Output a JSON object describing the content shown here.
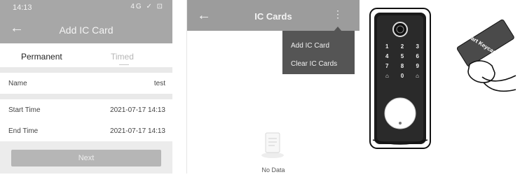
{
  "screen_add_ic_card": {
    "status_time": "14:13",
    "status_icons": "4G ✓ ⊡",
    "title": "Add IC Card",
    "tabs": [
      "Permanent",
      "Timed"
    ],
    "rows": [
      {
        "label": "Name",
        "value": "test"
      },
      {
        "label": "Start Time",
        "value": "2021-07-17 14:13"
      },
      {
        "label": "End Time",
        "value": "2021-07-17 14:13"
      }
    ],
    "next_label": "Next"
  },
  "screen_ic_cards": {
    "title": "IC Cards",
    "menu": [
      "Add IC Card",
      "Clear IC Cards"
    ],
    "empty_text": "No Data"
  },
  "illustration": {
    "keypad_keys": [
      "1",
      "2",
      "3",
      "4",
      "5",
      "6",
      "7",
      "8",
      "9",
      "",
      "0",
      ""
    ],
    "card_text": "Smart Keycard"
  }
}
